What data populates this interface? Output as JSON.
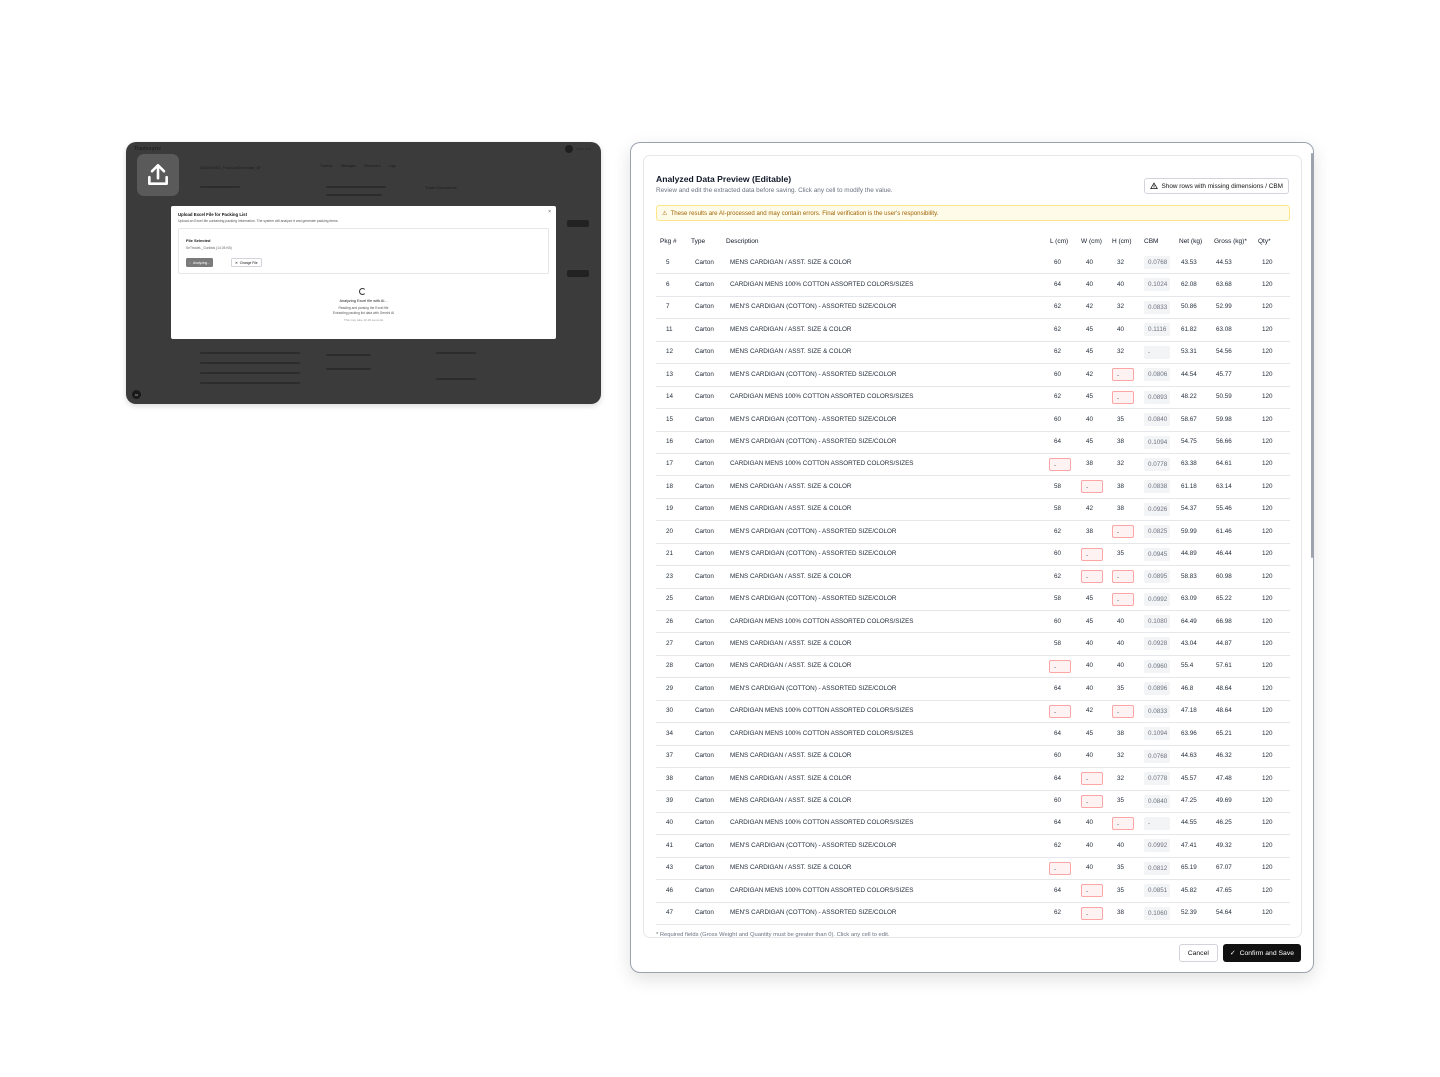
{
  "background_app": {
    "brand": "Tradesync",
    "user_name": "Jane Kim",
    "page_title": "2025V0302_PackListGenerate_87",
    "tabs": [
      "Timeline",
      "Messages",
      "Reminders",
      "Logs"
    ],
    "documents_title": "Trade Documents",
    "upload_modal": {
      "title": "Upload Excel File for Packing List",
      "subtitle": "Upload an Excel file containing packing information. The system will analyze it and generate packing items.",
      "file_selected_label": "File Selected",
      "file_name": "SeTtradeL_Gunlists (14.05 KB)",
      "analyzing_button": "Analyzing...",
      "change_file_button": "Change File",
      "status_title": "Analyzing Excel file with AI...",
      "status_line1": "Reading and parsing the Excel file",
      "status_line2": "Extracting packing list data with Gemini AI",
      "status_line3": "This may take 10-30 seconds",
      "close_label": "×"
    },
    "avatar_initial": "N"
  },
  "preview": {
    "title": "Analyzed Data Preview (Editable)",
    "subtitle": "Review and edit the extracted data before saving. Click any cell to modify the value.",
    "missing_button": "Show rows with missing dimensions / CBM",
    "warning": "These results are AI-processed and may contain errors. Final verification is the user's responsibility.",
    "columns": [
      "Pkg #",
      "Type",
      "Description",
      "L (cm)",
      "W (cm)",
      "H (cm)",
      "CBM",
      "Net (kg)",
      "Gross (kg)*",
      "Qty*"
    ],
    "rows": [
      [
        "5",
        "Carton",
        "MENS CARDIGAN / ASST. SIZE & COLOR",
        "60",
        "40",
        "32",
        "0.0768",
        "43.53",
        "44.53",
        "120"
      ],
      [
        "6",
        "Carton",
        "CARDIGAN MENS 100% COTTON ASSORTED COLORS/SIZES",
        "64",
        "40",
        "40",
        "0.1024",
        "62.08",
        "63.68",
        "120"
      ],
      [
        "7",
        "Carton",
        "MEN'S CARDIGAN (COTTON) - ASSORTED SIZE/COLOR",
        "62",
        "42",
        "32",
        "0.0833",
        "50.86",
        "52.99",
        "120"
      ],
      [
        "11",
        "Carton",
        "MENS CARDIGAN / ASST. SIZE & COLOR",
        "62",
        "45",
        "40",
        "0.1116",
        "61.82",
        "63.08",
        "120"
      ],
      [
        "12",
        "Carton",
        "MENS CARDIGAN / ASST. SIZE & COLOR",
        "62",
        "45",
        "32",
        "-",
        "53.31",
        "54.56",
        "120"
      ],
      [
        "13",
        "Carton",
        "MEN'S CARDIGAN (COTTON) - ASSORTED SIZE/COLOR",
        "60",
        "42",
        "-",
        "0.0806",
        "44.54",
        "45.77",
        "120"
      ],
      [
        "14",
        "Carton",
        "CARDIGAN MENS 100% COTTON ASSORTED COLORS/SIZES",
        "62",
        "45",
        "-",
        "0.0893",
        "48.22",
        "50.59",
        "120"
      ],
      [
        "15",
        "Carton",
        "MEN'S CARDIGAN (COTTON) - ASSORTED SIZE/COLOR",
        "60",
        "40",
        "35",
        "0.0840",
        "58.67",
        "59.98",
        "120"
      ],
      [
        "16",
        "Carton",
        "MEN'S CARDIGAN (COTTON) - ASSORTED SIZE/COLOR",
        "64",
        "45",
        "38",
        "0.1094",
        "54.75",
        "56.66",
        "120"
      ],
      [
        "17",
        "Carton",
        "CARDIGAN MENS 100% COTTON ASSORTED COLORS/SIZES",
        "-",
        "38",
        "32",
        "0.0778",
        "63.38",
        "64.61",
        "120"
      ],
      [
        "18",
        "Carton",
        "MENS CARDIGAN / ASST. SIZE & COLOR",
        "58",
        "-",
        "38",
        "0.0838",
        "61.18",
        "63.14",
        "120"
      ],
      [
        "19",
        "Carton",
        "MENS CARDIGAN / ASST. SIZE & COLOR",
        "58",
        "42",
        "38",
        "0.0926",
        "54.37",
        "55.46",
        "120"
      ],
      [
        "20",
        "Carton",
        "MEN'S CARDIGAN (COTTON) - ASSORTED SIZE/COLOR",
        "62",
        "38",
        "-",
        "0.0825",
        "59.99",
        "61.46",
        "120"
      ],
      [
        "21",
        "Carton",
        "MEN'S CARDIGAN (COTTON) - ASSORTED SIZE/COLOR",
        "60",
        "-",
        "35",
        "0.0945",
        "44.89",
        "46.44",
        "120"
      ],
      [
        "23",
        "Carton",
        "MENS CARDIGAN / ASST. SIZE & COLOR",
        "62",
        "-",
        "-",
        "0.0895",
        "58.83",
        "60.98",
        "120"
      ],
      [
        "25",
        "Carton",
        "MEN'S CARDIGAN (COTTON) - ASSORTED SIZE/COLOR",
        "58",
        "45",
        "-",
        "0.0992",
        "63.09",
        "65.22",
        "120"
      ],
      [
        "26",
        "Carton",
        "CARDIGAN MENS 100% COTTON ASSORTED COLORS/SIZES",
        "60",
        "45",
        "40",
        "0.1080",
        "64.49",
        "66.98",
        "120"
      ],
      [
        "27",
        "Carton",
        "MENS CARDIGAN / ASST. SIZE & COLOR",
        "58",
        "40",
        "40",
        "0.0928",
        "43.04",
        "44.87",
        "120"
      ],
      [
        "28",
        "Carton",
        "MENS CARDIGAN / ASST. SIZE & COLOR",
        "-",
        "40",
        "40",
        "0.0960",
        "55.4",
        "57.61",
        "120"
      ],
      [
        "29",
        "Carton",
        "MEN'S CARDIGAN (COTTON) - ASSORTED SIZE/COLOR",
        "64",
        "40",
        "35",
        "0.0896",
        "46.8",
        "48.64",
        "120"
      ],
      [
        "30",
        "Carton",
        "CARDIGAN MENS 100% COTTON ASSORTED COLORS/SIZES",
        "-",
        "42",
        "-",
        "0.0833",
        "47.18",
        "48.64",
        "120"
      ],
      [
        "34",
        "Carton",
        "CARDIGAN MENS 100% COTTON ASSORTED COLORS/SIZES",
        "64",
        "45",
        "38",
        "0.1094",
        "63.96",
        "65.21",
        "120"
      ],
      [
        "37",
        "Carton",
        "MENS CARDIGAN / ASST. SIZE & COLOR",
        "60",
        "40",
        "32",
        "0.0768",
        "44.63",
        "46.32",
        "120"
      ],
      [
        "38",
        "Carton",
        "MENS CARDIGAN / ASST. SIZE & COLOR",
        "64",
        "-",
        "32",
        "0.0778",
        "45.57",
        "47.48",
        "120"
      ],
      [
        "39",
        "Carton",
        "MENS CARDIGAN / ASST. SIZE & COLOR",
        "60",
        "-",
        "35",
        "0.0840",
        "47.25",
        "49.69",
        "120"
      ],
      [
        "40",
        "Carton",
        "CARDIGAN MENS 100% COTTON ASSORTED COLORS/SIZES",
        "64",
        "40",
        "-",
        "-",
        "44.55",
        "46.25",
        "120"
      ],
      [
        "41",
        "Carton",
        "MEN'S CARDIGAN (COTTON) - ASSORTED SIZE/COLOR",
        "62",
        "40",
        "40",
        "0.0992",
        "47.41",
        "49.32",
        "120"
      ],
      [
        "43",
        "Carton",
        "MENS CARDIGAN / ASST. SIZE & COLOR",
        "-",
        "40",
        "35",
        "0.0812",
        "65.19",
        "67.07",
        "120"
      ],
      [
        "46",
        "Carton",
        "CARDIGAN MENS 100% COTTON ASSORTED COLORS/SIZES",
        "64",
        "-",
        "35",
        "0.0851",
        "45.82",
        "47.65",
        "120"
      ],
      [
        "47",
        "Carton",
        "MEN'S CARDIGAN (COTTON) - ASSORTED SIZE/COLOR",
        "62",
        "-",
        "38",
        "0.1060",
        "52.39",
        "54.64",
        "120"
      ]
    ],
    "footnote": "* Required fields (Gross Weight and Quantity must be greater than 0). Click any cell to edit.",
    "cancel_label": "Cancel",
    "confirm_label": "Confirm and Save"
  }
}
